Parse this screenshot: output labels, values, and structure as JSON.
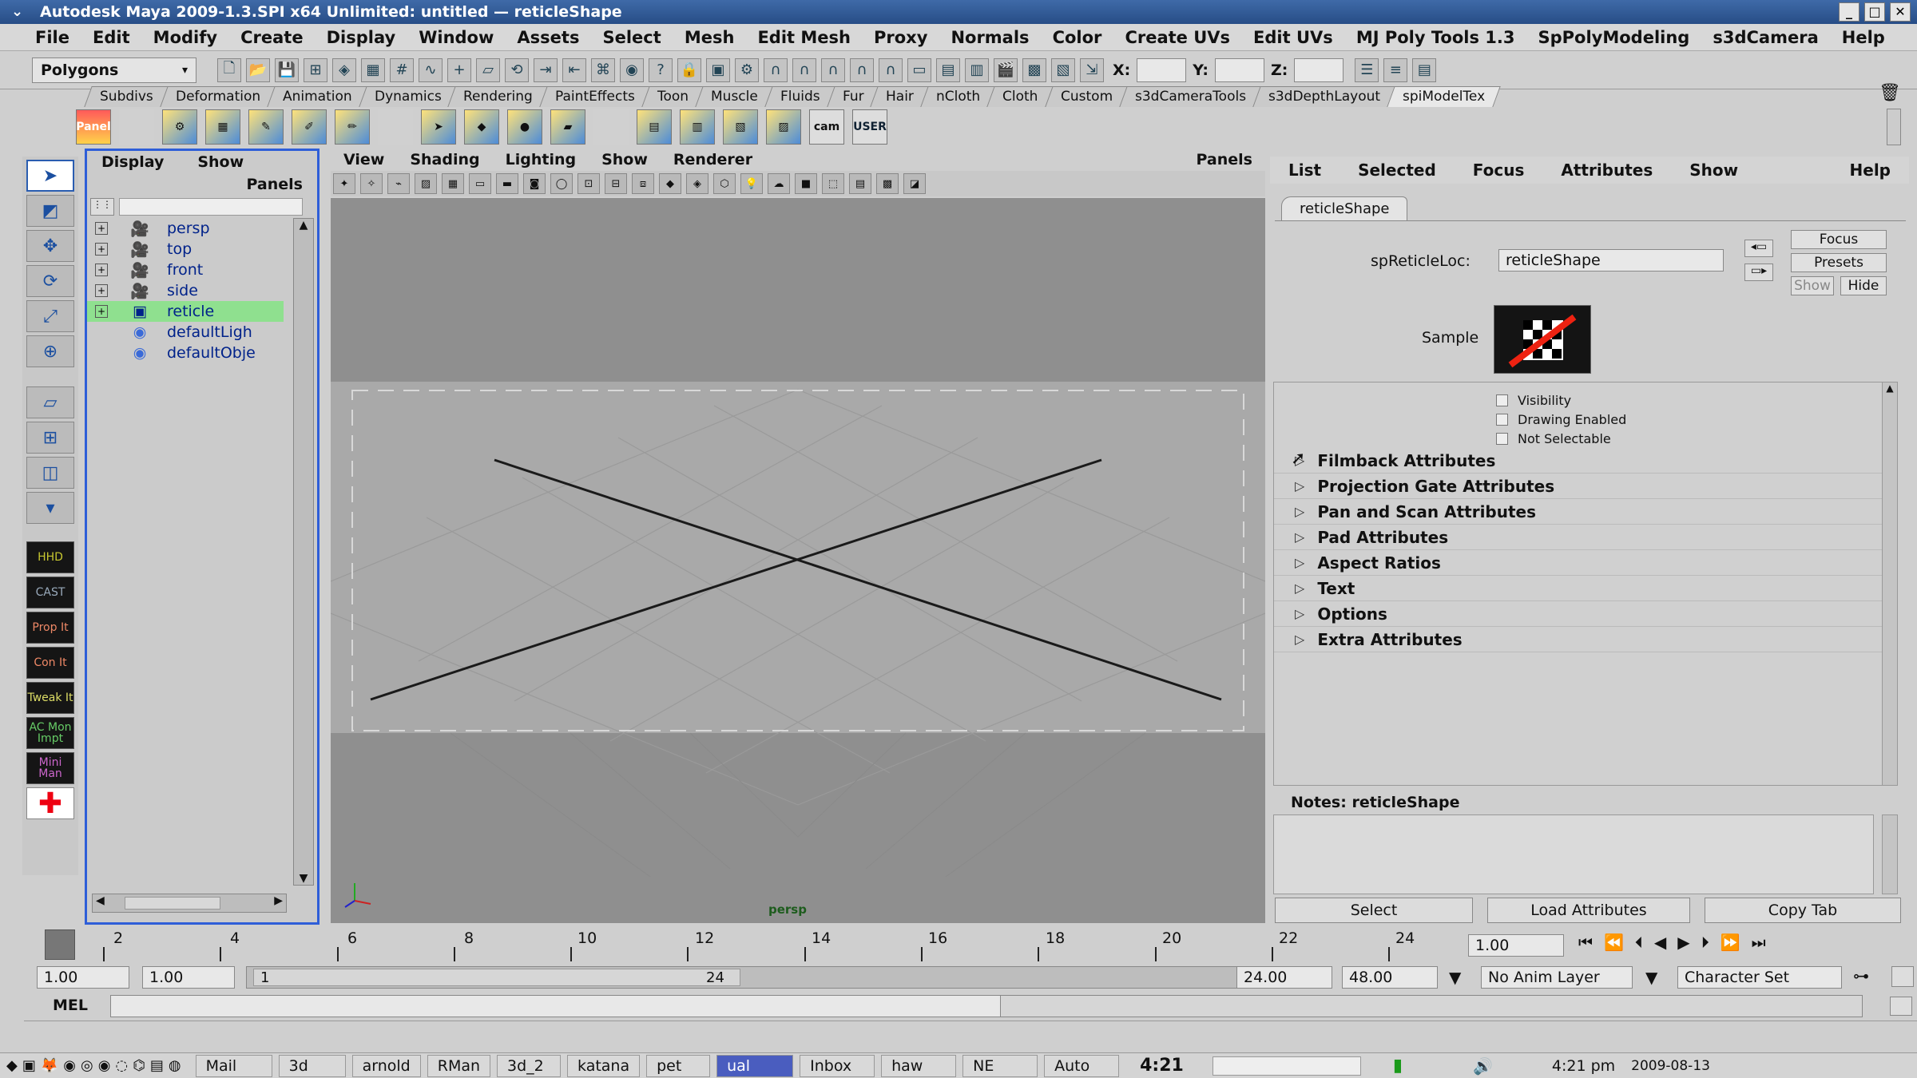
{
  "window": {
    "title": "Autodesk Maya 2009-1.3.SPI x64 Unlimited: untitled   —   reticleShape"
  },
  "menu": [
    "File",
    "Edit",
    "Modify",
    "Create",
    "Display",
    "Window",
    "Assets",
    "Select",
    "Mesh",
    "Edit Mesh",
    "Proxy",
    "Normals",
    "Color",
    "Create UVs",
    "Edit UVs",
    "MJ Poly Tools 1.3",
    "SpPolyModeling",
    "s3dCamera",
    "Help"
  ],
  "status_line": {
    "mode": "Polygons",
    "x_label": "X:",
    "y_label": "Y:",
    "z_label": "Z:"
  },
  "shelf_tabs": [
    "Subdivs",
    "Deformation",
    "Animation",
    "Dynamics",
    "Rendering",
    "PaintEffects",
    "Toon",
    "Muscle",
    "Fluids",
    "Fur",
    "Hair",
    "nCloth",
    "Cloth",
    "Custom",
    "s3dCameraTools",
    "s3dDepthLayout",
    "spiModelTex"
  ],
  "shelf_active": "spiModelTex",
  "shelf_labels": {
    "panel": "Panel",
    "cam": "cam",
    "user": "USER"
  },
  "toolbox_marks": [
    "HHD",
    "CAST",
    "Prop It",
    "Con It",
    "Tweak It",
    "AC Mon Impt",
    "Mini Man"
  ],
  "outliner": {
    "menu": [
      "Display",
      "Show"
    ],
    "panels": "Panels",
    "items": [
      {
        "label": "persp",
        "expand": "+"
      },
      {
        "label": "top",
        "expand": "+"
      },
      {
        "label": "front",
        "expand": "+"
      },
      {
        "label": "side",
        "expand": "+"
      },
      {
        "label": "reticle",
        "expand": "+"
      },
      {
        "label": "defaultLigh",
        "expand": ""
      },
      {
        "label": "defaultObje",
        "expand": ""
      }
    ]
  },
  "viewport": {
    "menu": [
      "View",
      "Shading",
      "Lighting",
      "Show",
      "Renderer"
    ],
    "panels": "Panels",
    "camera_label": "persp"
  },
  "attribute_editor": {
    "menu": [
      "List",
      "Selected",
      "Focus",
      "Attributes",
      "Show",
      "Help"
    ],
    "tab": "reticleShape",
    "loc_label": "spReticleLoc:",
    "loc_value": "reticleShape",
    "sample_label": "Sample",
    "side_buttons": [
      "Focus",
      "Presets",
      "Show",
      "Hide"
    ],
    "checkboxes": [
      "Visibility",
      "Drawing Enabled",
      "Not Selectable"
    ],
    "sections": [
      "Filmback Attributes",
      "Projection Gate Attributes",
      "Pan and Scan Attributes",
      "Pad Attributes",
      "Aspect Ratios",
      "Text",
      "Options",
      "Extra Attributes"
    ],
    "notes_label": "Notes:  reticleShape",
    "buttons": [
      "Select",
      "Load Attributes",
      "Copy Tab"
    ]
  },
  "timeline": {
    "ticks": [
      "2",
      "4",
      "6",
      "8",
      "10",
      "12",
      "14",
      "16",
      "18",
      "20",
      "22",
      "24"
    ],
    "current_frame": "1.00"
  },
  "range": {
    "start": "1.00",
    "playback_start": "1.00",
    "slider_min": "1",
    "slider_max": "24",
    "playback_end": "24.00",
    "end": "48.00",
    "anim_layer": "No Anim Layer",
    "char_set": "Character Set"
  },
  "command_line": {
    "label": "MEL"
  },
  "taskbar": {
    "items": [
      "Mail",
      "3d",
      "arnold",
      "RMan",
      "3d_2",
      "katana",
      "pet",
      "ual",
      "Inbox",
      "haw",
      "NE",
      "Auto"
    ],
    "active": "ual",
    "workspace": "4:21",
    "clock": "4:21 pm",
    "date": "2009-08-13"
  },
  "colors": {
    "outliner_highlight": "#8fe08f",
    "selected_panel_border": "#2e5ed8",
    "viewport_bg": "#8f8f8f",
    "film_gate": "#a9a9a9"
  }
}
